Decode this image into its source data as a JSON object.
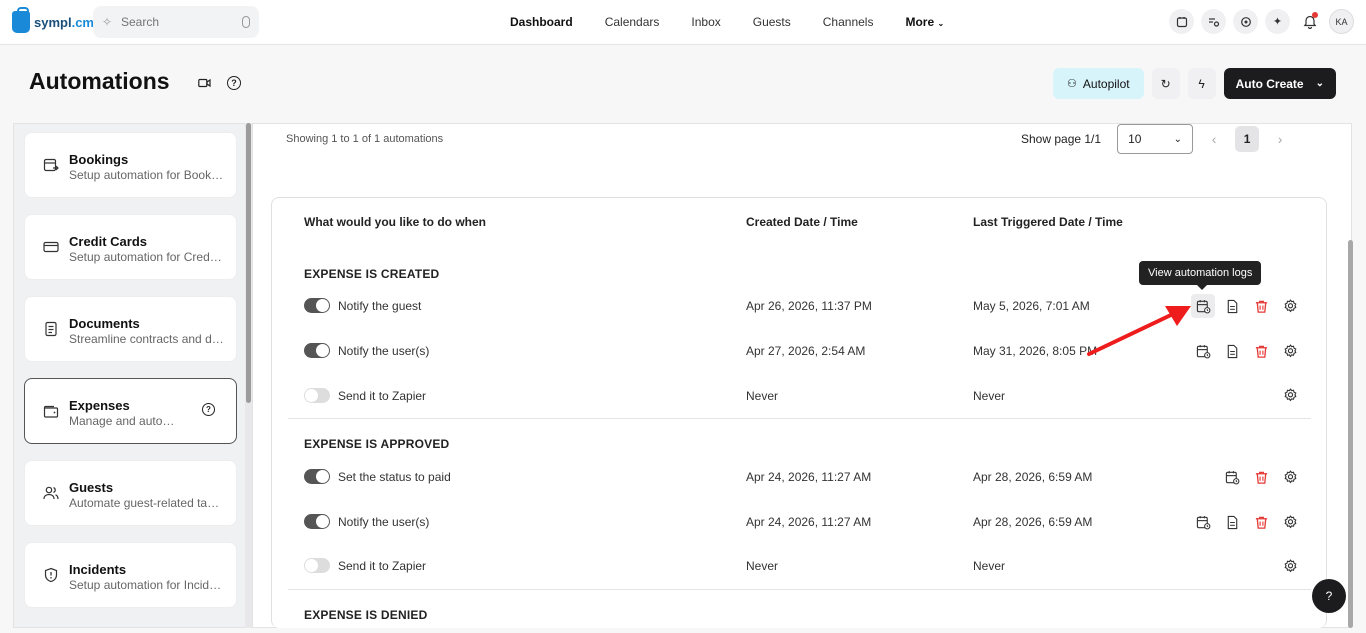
{
  "brand": {
    "name_a": "sympl",
    "name_b": ".cm"
  },
  "search": {
    "placeholder": "Search"
  },
  "nav": {
    "items": [
      "Dashboard",
      "Calendars",
      "Inbox",
      "Guests",
      "Channels"
    ],
    "more": "More"
  },
  "user": {
    "initials": "KA"
  },
  "page": {
    "title": "Automations"
  },
  "header_actions": {
    "autopilot": "Autopilot",
    "auto_create": "Auto Create"
  },
  "sidebar": {
    "items": [
      {
        "title": "Bookings",
        "subtitle": "Setup automation for Bookings",
        "icon": "calendar-arrow-icon"
      },
      {
        "title": "Credit Cards",
        "subtitle": "Setup automation for Credit Cards",
        "icon": "credit-card-icon"
      },
      {
        "title": "Documents",
        "subtitle": "Streamline contracts and documents",
        "icon": "document-icon"
      },
      {
        "title": "Expenses",
        "subtitle": "Manage and automate expenses",
        "icon": "wallet-icon"
      },
      {
        "title": "Guests",
        "subtitle": "Automate guest-related tasks",
        "icon": "users-icon"
      },
      {
        "title": "Incidents",
        "subtitle": "Setup automation for Incidents",
        "icon": "shield-alert-icon"
      }
    ],
    "active_index": 3
  },
  "listing": {
    "showing": "Showing 1 to 1 of 1 automations",
    "show_page": "Show page 1/1",
    "page_size": "10",
    "current_page": "1"
  },
  "table": {
    "headers": {
      "what": "What would you like to do when",
      "created": "Created Date / Time",
      "last": "Last Triggered Date / Time"
    },
    "sections": [
      {
        "title": "EXPENSE IS CREATED",
        "rows": [
          {
            "name": "Notify the guest",
            "enabled": true,
            "created": "Apr 26, 2026, 11:37 PM",
            "last": "May 5, 2026, 7:01 AM"
          },
          {
            "name": "Notify the user(s)",
            "enabled": true,
            "created": "Apr 27, 2026, 2:54 AM",
            "last": "May 31, 2026, 8:05 PM"
          },
          {
            "name": "Send it to Zapier",
            "enabled": false,
            "created": "Never",
            "last": "Never"
          }
        ]
      },
      {
        "title": "EXPENSE IS APPROVED",
        "rows": [
          {
            "name": "Set the status to paid",
            "enabled": true,
            "created": "Apr 24, 2026, 11:27 AM",
            "last": "Apr 28, 2026, 6:59 AM"
          },
          {
            "name": "Notify the user(s)",
            "enabled": true,
            "created": "Apr 24, 2026, 11:27 AM",
            "last": "Apr 28, 2026, 6:59 AM"
          },
          {
            "name": "Send it to Zapier",
            "enabled": false,
            "created": "Never",
            "last": "Never"
          }
        ]
      },
      {
        "title": "EXPENSE IS DENIED",
        "rows": []
      }
    ]
  },
  "tooltip": {
    "text": "View automation logs"
  },
  "help_fab": {
    "label": "?"
  },
  "colors": {
    "accent_delete": "#e53935",
    "autopilot_bg": "#d8f4fb",
    "dark_button": "#1c1c1e",
    "annotation_arrow": "#ee1c1c"
  }
}
